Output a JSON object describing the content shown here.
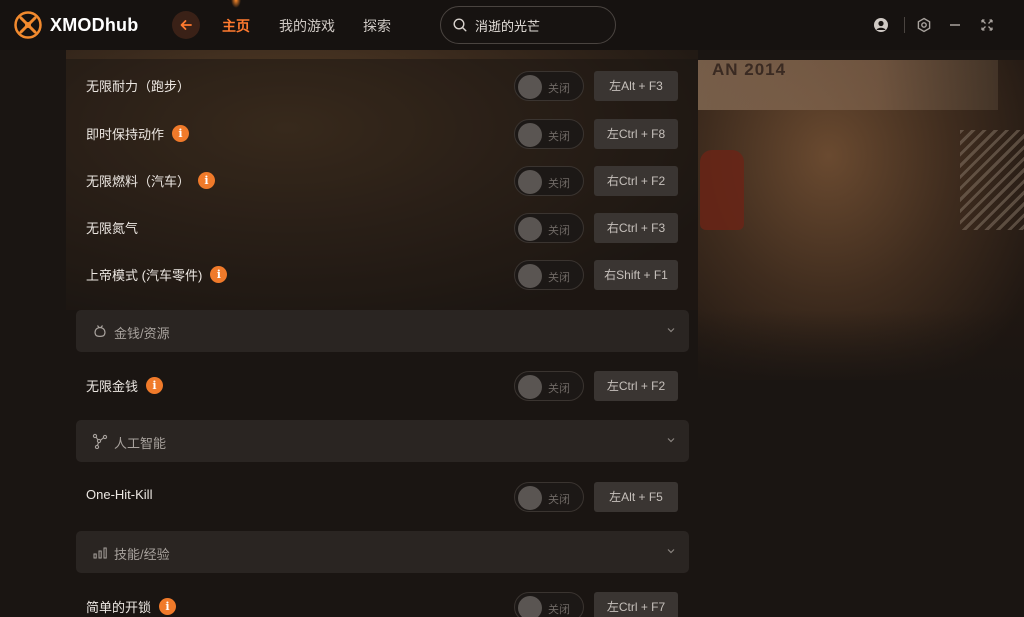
{
  "app": {
    "logo_name": "XMOD",
    "logo_suffix": "hub",
    "brand_color": "#ff7a2f"
  },
  "nav": {
    "items": [
      {
        "label": "主页",
        "active": true
      },
      {
        "label": "我的游戏",
        "active": false
      },
      {
        "label": "探索",
        "active": false
      }
    ]
  },
  "search": {
    "value": "消逝的光芒"
  },
  "background": {
    "banner_text": "AN 2014"
  },
  "rows": [
    {
      "label": "无限耐力（跑步）",
      "info": false,
      "toggle_text": "关闭",
      "hotkey": "左Alt + F3"
    },
    {
      "label": "即时保持动作",
      "info": true,
      "toggle_text": "关闭",
      "hotkey": "左Ctrl + F8"
    },
    {
      "label": "无限燃料（汽车）",
      "info": true,
      "toggle_text": "关闭",
      "hotkey": "右Ctrl + F2"
    },
    {
      "label": "无限氮气",
      "info": false,
      "toggle_text": "关闭",
      "hotkey": "右Ctrl + F3"
    },
    {
      "label": "上帝模式 (汽车零件)",
      "info": true,
      "toggle_text": "关闭",
      "hotkey": "右Shift + F1"
    }
  ],
  "sections": [
    {
      "label": "金钱/资源",
      "icon": "money-bag-icon",
      "rows": [
        {
          "label": "无限金钱",
          "info": true,
          "toggle_text": "关闭",
          "hotkey": "左Ctrl + F2"
        }
      ]
    },
    {
      "label": "人工智能",
      "icon": "ai-network-icon",
      "rows": [
        {
          "label": "One-Hit-Kill",
          "info": false,
          "toggle_text": "关闭",
          "hotkey": "左Alt + F5"
        }
      ]
    },
    {
      "label": "技能/经验",
      "icon": "bar-chart-icon",
      "rows": [
        {
          "label": "简单的开锁",
          "info": true,
          "toggle_text": "关闭",
          "hotkey": "左Ctrl + F7"
        }
      ]
    }
  ],
  "info_glyph": "i"
}
